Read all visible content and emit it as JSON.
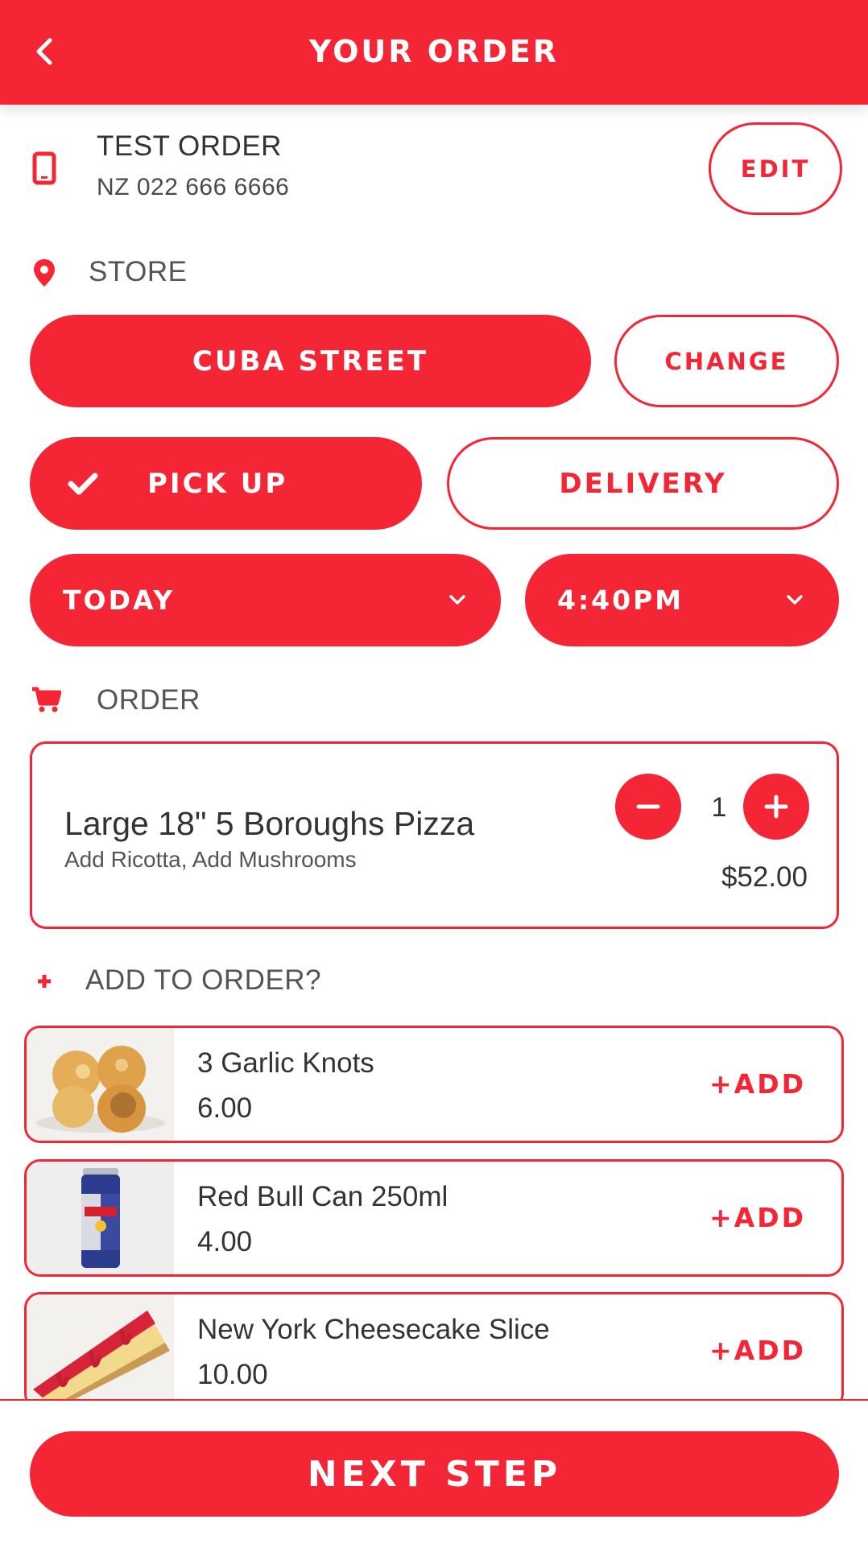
{
  "header": {
    "title": "YOUR ORDER"
  },
  "customer": {
    "name": "TEST ORDER",
    "phone": "NZ 022 666 6666",
    "edit_label": "EDIT"
  },
  "store": {
    "section_label": "STORE",
    "selected_store": "CUBA STREET",
    "change_label": "CHANGE"
  },
  "fulfilment": {
    "pickup_label": "PICK UP",
    "delivery_label": "DELIVERY",
    "selected": "PICK UP"
  },
  "schedule": {
    "day": "TODAY",
    "time": "4:40PM"
  },
  "order": {
    "section_label": "ORDER",
    "items": [
      {
        "name": "Large 18\" 5 Boroughs Pizza",
        "modifiers": "Add Ricotta, Add Mushrooms",
        "quantity": "1",
        "price": "$52.00"
      }
    ]
  },
  "upsell": {
    "section_label": "ADD TO ORDER?",
    "add_label": "+ADD",
    "items": [
      {
        "name": "3 Garlic Knots",
        "price": "6.00"
      },
      {
        "name": "Red Bull Can 250ml",
        "price": "4.00"
      },
      {
        "name": "New York Cheesecake Slice",
        "price": "10.00"
      }
    ]
  },
  "footer": {
    "next_label": "NEXT STEP"
  },
  "colors": {
    "accent": "#f42534",
    "text": "#333333",
    "white": "#ffffff"
  },
  "icons": [
    "back-arrow-icon",
    "phone-icon",
    "location-pin-icon",
    "checkmark-icon",
    "chevron-down-icon",
    "cart-icon",
    "plus-icon",
    "minus-icon"
  ]
}
